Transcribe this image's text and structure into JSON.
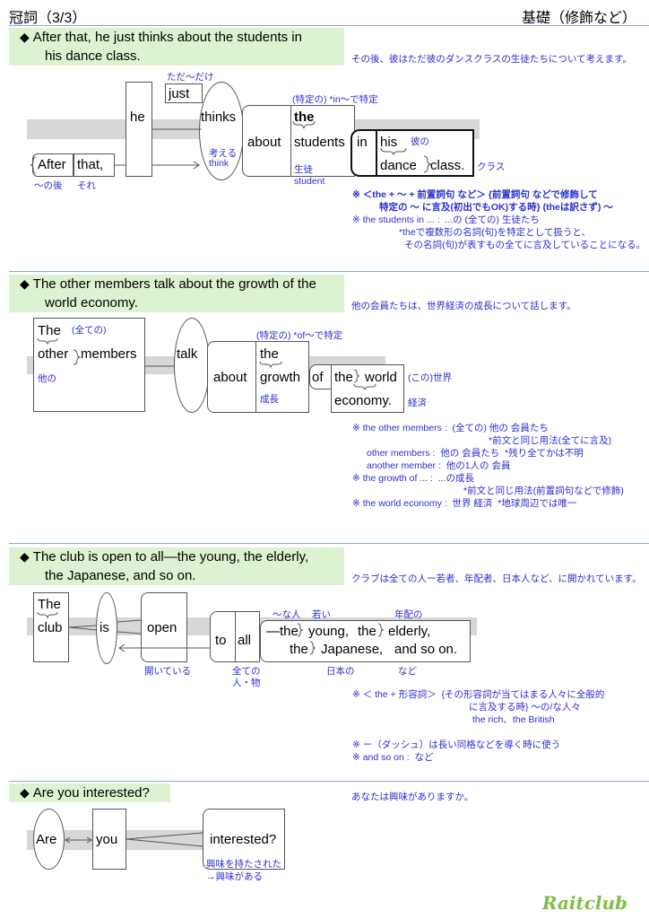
{
  "header": {
    "title": "冠詞（3/3）",
    "category": "基礎（修飾など）"
  },
  "sections": [
    {
      "sentence_line1": "After that, he just thinks about the students in",
      "sentence_line2": "his dance class.",
      "translation": "その後、彼はただ彼のダンスクラスの生徒たちについて考えます。",
      "words": {
        "after": "After",
        "that": "that,",
        "he": "he",
        "just": "just",
        "thinks": "thinks",
        "about": "about",
        "the": "the",
        "students": "students",
        "in": "in",
        "his": "his",
        "dance": "dance",
        "class": "class."
      },
      "glosses": {
        "after": "～の後",
        "that": "それ",
        "just": "ただ～だけ",
        "thinks_ja": "考える",
        "thinks_en": "think",
        "the": "(特定の) *in～で特定",
        "students_ja": "生徒",
        "students_en": "student",
        "his": "彼の",
        "class": "クラス"
      },
      "notes": [
        "※ ＜the + ～ + 前置詞句 など＞ {前置詞句 などで修飾して",
        "特定の ～ に言及(初出でもOK)する時} (theは訳さず) ～",
        "※ the students in ... :  ...の (全ての) 生徒たち",
        "*theで複数形の名詞(句)を特定として扱うと、",
        "その名詞(句)が表すもの全てに言及していることになる。"
      ]
    },
    {
      "sentence_line1": "The other members talk about the growth of the",
      "sentence_line2": "world economy.",
      "translation": "他の会員たちは、世界経済の成長について話します。",
      "words": {
        "the": "The",
        "other": "other",
        "members": "members",
        "talk": "talk",
        "about": "about",
        "the2": "the",
        "growth": "growth",
        "of": "of",
        "the3": "the",
        "world": "world",
        "economy": "economy."
      },
      "glosses": {
        "the": "(全ての)",
        "other": "他の",
        "the2": "(特定の) *of～で特定",
        "growth": "成長",
        "world": "(この)世界",
        "economy": "経済"
      },
      "notes": [
        "※ the other members :  (全ての) 他の 会員たち",
        "*前文と同じ用法(全てに言及)",
        "other members :  他の 会員たち  *残り全てかは不明",
        "another member :  他の1人の 会員",
        "※ the growth of ... :  ...の成長",
        "*前文と同じ用法(前置詞句などで修飾)",
        "※ the world economy :  世界 経済  *地球周辺では唯一"
      ]
    },
    {
      "sentence_line1": "The club is open to all—the young, the elderly,",
      "sentence_line2": "the Japanese, and so on.",
      "translation": "クラブは全ての人ー若者、年配者、日本人など、に開かれています。",
      "words": {
        "the": "The",
        "club": "club",
        "is": "is",
        "open": "open",
        "to": "to",
        "all": "all",
        "dash_the": "—the",
        "young": "young,",
        "the2": "the",
        "elderly": "elderly,",
        "the3": "the",
        "japanese": "Japanese,",
        "andsoon": "and so on."
      },
      "glosses": {
        "the": "～な人",
        "young": "若い",
        "elderly": "年配の",
        "open": "開いている",
        "all_1": "全ての",
        "all_2": "人・物",
        "japanese": "日本の",
        "andsoon": "など"
      },
      "notes": [
        "※ ＜ the + 形容詞＞  {その形容詞が当てはまる人々に全般的",
        "に言及する時} ～の/な人々",
        "the rich、the British",
        "※ ー（ダッシュ）は長い同格などを導く時に使う",
        "※ and so on :  など"
      ]
    },
    {
      "sentence_line1": "Are you interested?",
      "translation": "あなたは興味がありますか。",
      "words": {
        "are": "Are",
        "you": "you",
        "interested": "interested?"
      },
      "glosses": {
        "interested_1": "興味を持たされた",
        "interested_2": "→興味がある"
      }
    }
  ],
  "logo": "Raitclub",
  "colors": {
    "banner_bg": "#dcf2d0",
    "gloss_blue": "#2b2fd0",
    "rule": "#8fa9d4",
    "logo": "#7cc142"
  }
}
